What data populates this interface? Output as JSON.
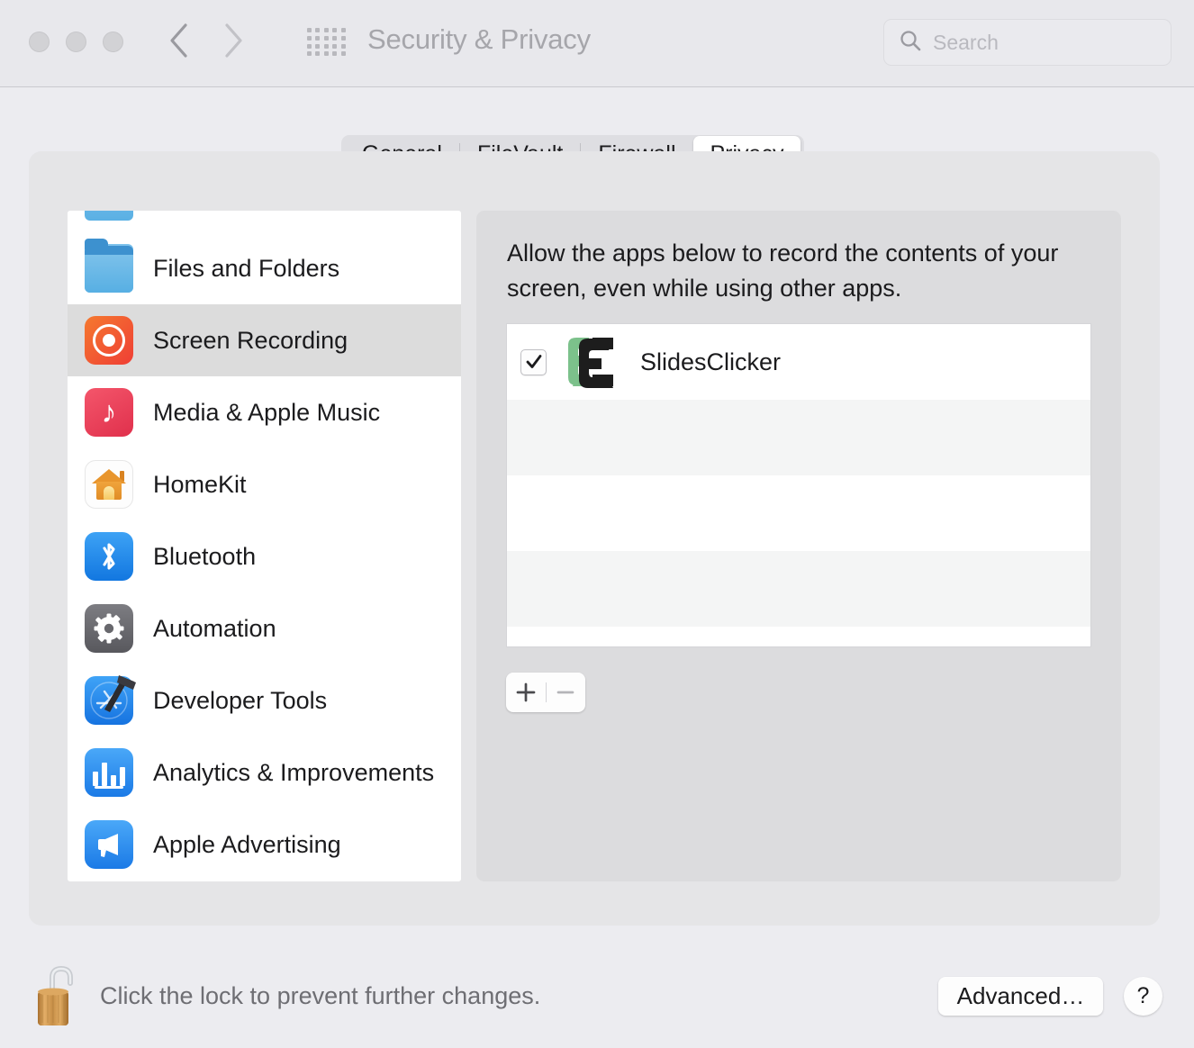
{
  "window": {
    "title": "Security & Privacy",
    "traffic_lights": [
      "close",
      "minimize",
      "zoom"
    ],
    "back_icon": "chevron-left-icon",
    "forward_icon": "chevron-right-icon",
    "grid_icon": "show-all-grid-icon"
  },
  "search": {
    "placeholder": "Search",
    "value": "",
    "icon": "search-icon"
  },
  "tabs": [
    {
      "label": "General",
      "selected": false
    },
    {
      "label": "FileVault",
      "selected": false
    },
    {
      "label": "Firewall",
      "selected": false
    },
    {
      "label": "Privacy",
      "selected": true
    }
  ],
  "sidebar": {
    "items": [
      {
        "label": "",
        "icon": "partial-blue-icon",
        "selected": false,
        "partial": true
      },
      {
        "label": "Files and Folders",
        "icon": "folder-icon",
        "selected": false
      },
      {
        "label": "Screen Recording",
        "icon": "screen-recording-icon",
        "selected": true
      },
      {
        "label": "Media & Apple Music",
        "icon": "music-note-icon",
        "selected": false
      },
      {
        "label": "HomeKit",
        "icon": "homekit-house-icon",
        "selected": false
      },
      {
        "label": "Bluetooth",
        "icon": "bluetooth-icon",
        "selected": false
      },
      {
        "label": "Automation",
        "icon": "gear-icon",
        "selected": false
      },
      {
        "label": "Developer Tools",
        "icon": "xcode-hammer-icon",
        "selected": false
      },
      {
        "label": "Analytics & Improvements",
        "icon": "bar-chart-icon",
        "selected": false
      },
      {
        "label": "Apple Advertising",
        "icon": "megaphone-icon",
        "selected": false
      }
    ]
  },
  "detail": {
    "description": "Allow the apps below to record the contents of your screen, even while using other apps.",
    "apps": [
      {
        "name": "SlidesClicker",
        "checked": true,
        "icon": "slidesclicker-icon"
      },
      {
        "name": "",
        "checked": false,
        "icon": ""
      },
      {
        "name": "",
        "checked": false,
        "icon": ""
      },
      {
        "name": "",
        "checked": false,
        "icon": ""
      }
    ],
    "add_button_label": "+",
    "remove_button_label": "−"
  },
  "bottom": {
    "lock_icon": "unlocked-padlock-icon",
    "lock_message": "Click the lock to prevent further changes.",
    "advanced_label": "Advanced…",
    "help_label": "?"
  },
  "colors": {
    "window_background": "#ececf0",
    "titlebar_background": "#e8e8ec",
    "panel_background": "#e5e5e7",
    "detail_background": "#dcdcde",
    "list_background": "#ffffff",
    "list_alt_row": "#f4f5f5",
    "sidebar_selected": "#dcdcdc",
    "title_text": "#a6a6ab",
    "body_text": "#1b1b1d",
    "muted_text": "#6e6e73",
    "slidesclicker_green": "#7cc18b",
    "slidesclicker_black": "#1d1d1d",
    "screen_recording_red": "#ef3e35",
    "lock_gold": "#d39b4e"
  }
}
